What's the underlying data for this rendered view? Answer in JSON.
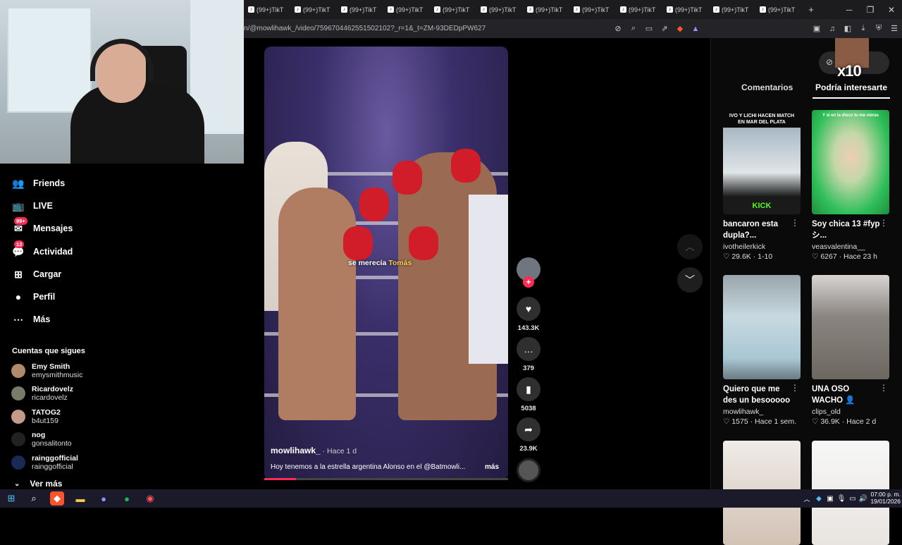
{
  "browser": {
    "tabs": [
      "(99+)TikT",
      "(99+)TikT",
      "(99+)TikT",
      "(99+)TikT",
      "(99+)TikT",
      "(99+)TikT",
      "(99+)TikT",
      "(99+)TikT",
      "(99+)TikT",
      "(99+)TikT",
      "(99+)TikT",
      "(99+)TikT"
    ],
    "new_tab": "+",
    "url": "n/@mowlihawk_/video/7596704462551502102?_r=1&_t=ZM-93DEDpPW627"
  },
  "sidebar": {
    "nav": [
      {
        "label": "Friends",
        "icon": "friends-icon"
      },
      {
        "label": "LIVE",
        "icon": "live-icon"
      },
      {
        "label": "Mensajes",
        "icon": "messages-icon",
        "badge": "99+"
      },
      {
        "label": "Actividad",
        "icon": "activity-icon",
        "badge": "13"
      },
      {
        "label": "Cargar",
        "icon": "upload-icon"
      },
      {
        "label": "Perfil",
        "icon": "profile-icon"
      },
      {
        "label": "Más",
        "icon": "more-icon"
      }
    ],
    "following_header": "Cuentas que sigues",
    "following": [
      {
        "name": "Emy Smith",
        "user": "emysmithmusic",
        "color": "#b08a6a"
      },
      {
        "name": "Ricardovelz",
        "user": "ricardovelz",
        "color": "#7a7a6a"
      },
      {
        "name": "TATOG2",
        "user": "b4ut159",
        "color": "#c49a8a"
      },
      {
        "name": "nog",
        "user": "gonsalitonto",
        "color": "#222222"
      },
      {
        "name": "rainggofficial",
        "user": "rainggofficial",
        "color": "#1a2a55"
      }
    ],
    "see_more": "Ver más"
  },
  "video": {
    "caption_prefix": "se merecía",
    "caption_highlight": "Tomás",
    "author": "mowlihawk_",
    "date": " · Hace 1 d",
    "description": "Hoy tenemos a la estrella argentina Alonso en el @Batmowli...",
    "more": "más",
    "progress": 0.13
  },
  "actions": [
    {
      "name": "like",
      "icon": "heart-icon",
      "glyph": "♥",
      "count": "143.3K"
    },
    {
      "name": "comment",
      "icon": "comment-icon",
      "glyph": "…",
      "count": "379"
    },
    {
      "name": "save",
      "icon": "bookmark-icon",
      "glyph": "▮",
      "count": "5038"
    },
    {
      "name": "share",
      "icon": "share-icon",
      "glyph": "➦",
      "count": "23.9K"
    }
  ],
  "overlay": {
    "multiplier": "x10"
  },
  "panel": {
    "tabs": [
      "Comentarios",
      "Podría interesarte"
    ],
    "cards": [
      {
        "title": "bancaron esta dupla?...",
        "user": "ivotheilerkick",
        "likes": "29.6K",
        "date": "1-10",
        "thumb_top": "IVO Y LICHI HACEN MATCH EN MAR DEL PLATA",
        "thumb_bottom": "KICK"
      },
      {
        "title": "Soy chica 13 #fyp シ...",
        "user": "veasvalentina__",
        "likes": "6267",
        "date": "Hace 23 h",
        "thumb_top": "Y si en la disco tu me vieras",
        "thumb_bottom": ""
      },
      {
        "title": "Quiero que me des un besooooo ♥",
        "user": "mowlihawk_",
        "likes": "1575",
        "date": "Hace 1 sem.",
        "thumb_top": "",
        "thumb_bottom": ""
      },
      {
        "title": "UNA OSO WACHO 👤 #momo #cos...",
        "user": "clips_old",
        "likes": "36.9K",
        "date": "Hace 2 d",
        "thumb_top": "",
        "thumb_bottom": ""
      }
    ]
  },
  "taskbar": {
    "time": "07:00 p. m.",
    "date": "19/01/2026"
  }
}
